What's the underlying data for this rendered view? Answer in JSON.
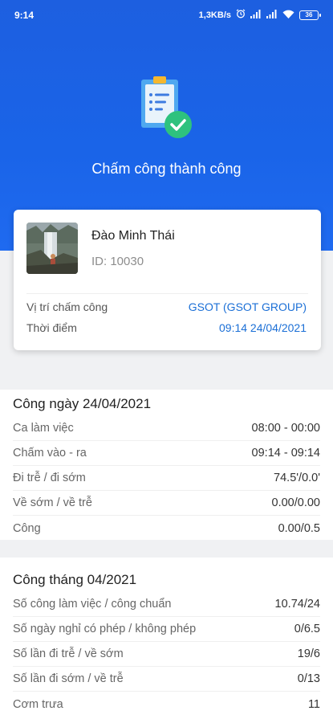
{
  "status_bar": {
    "time": "9:14",
    "speed": "1,3KB/s",
    "battery": "36"
  },
  "hero": {
    "title": "Chấm công thành công",
    "accent_color": "#1a64e8"
  },
  "employee": {
    "name": "Đào Minh Thái",
    "id_text": "ID: 10030"
  },
  "checkin": {
    "location_label": "Vị trí chấm công",
    "location_value": "GSOT (GSOT GROUP)",
    "time_label": "Thời điểm",
    "time_value": "09:14 24/04/2021"
  },
  "day_summary": {
    "title": "Công ngày 24/04/2021",
    "rows": [
      {
        "label": "Ca làm việc",
        "value": "08:00 - 00:00"
      },
      {
        "label": "Chấm vào - ra",
        "value": "09:14 - 09:14"
      },
      {
        "label": "Đi trễ / đi sớm",
        "value": "74.5'/0.0'"
      },
      {
        "label": "Về sớm / về trễ",
        "value": "0.00/0.00"
      },
      {
        "label": "Công",
        "value": "0.00/0.5"
      }
    ]
  },
  "month_summary": {
    "title": "Công tháng 04/2021",
    "rows": [
      {
        "label": "Số công làm việc / công chuẩn",
        "value": "10.74/24"
      },
      {
        "label": "Số ngày nghỉ có phép / không phép",
        "value": "0/6.5"
      },
      {
        "label": "Số lần đi trễ / về sớm",
        "value": "19/6"
      },
      {
        "label": "Số lần đi sớm / về trễ",
        "value": "0/13"
      },
      {
        "label": "Cơm trưa",
        "value": "11"
      }
    ]
  }
}
